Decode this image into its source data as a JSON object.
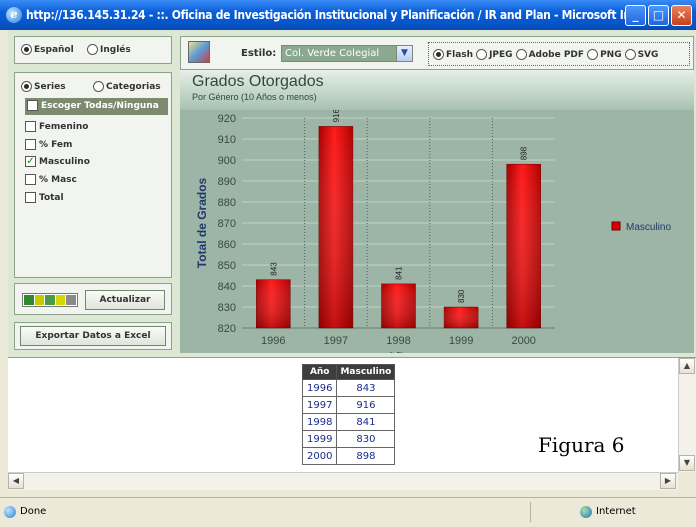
{
  "window": {
    "title": "http://136.145.31.24 - ::. Oficina de Investigación Institucional y Planificación / IR and Plan - Microsoft In..."
  },
  "language": {
    "option1": "Español",
    "option2": "Inglés",
    "selected": "Español"
  },
  "mode": {
    "option1": "Series",
    "option2": "Categorias",
    "selected": "Series"
  },
  "series_list": {
    "header": "Escoger Todas/Ninguna",
    "items": [
      {
        "label": "Femenino",
        "checked": false
      },
      {
        "label": "% Fem",
        "checked": false
      },
      {
        "label": "Masculino",
        "checked": true
      },
      {
        "label": "% Masc",
        "checked": false
      },
      {
        "label": "Total",
        "checked": false
      }
    ]
  },
  "buttons": {
    "update": "Actualizar",
    "export": "Exportar Datos a Excel"
  },
  "toolbar": {
    "style_label": "Estilo:",
    "style_value": "Col. Verde Colegial",
    "formats": [
      "Flash",
      "JPEG",
      "Adobe PDF",
      "PNG",
      "SVG"
    ],
    "selected_format": "Flash"
  },
  "chart_data": {
    "type": "bar",
    "title": "Grados Otorgados",
    "subtitle": "Por Género (10 Años o menos)",
    "xlabel": "Año",
    "ylabel": "Total de Grados",
    "categories": [
      "1996",
      "1997",
      "1998",
      "1999",
      "2000"
    ],
    "series": [
      {
        "name": "Masculino",
        "values": [
          843,
          916,
          841,
          830,
          898
        ]
      }
    ],
    "ylim": [
      820,
      920
    ],
    "yticks": [
      820,
      830,
      840,
      850,
      860,
      870,
      880,
      890,
      900,
      910,
      920
    ],
    "grid": true,
    "legend": "right",
    "colors": {
      "bar": "#d90000",
      "background": "#9db5a6"
    }
  },
  "table": {
    "headers": [
      "Año",
      "Masculino"
    ],
    "rows": [
      [
        "1996",
        "843"
      ],
      [
        "1997",
        "916"
      ],
      [
        "1998",
        "841"
      ],
      [
        "1999",
        "830"
      ],
      [
        "2000",
        "898"
      ]
    ]
  },
  "figure_caption": "Figura 6",
  "statusbar": {
    "left": "Done",
    "right": "Internet"
  }
}
